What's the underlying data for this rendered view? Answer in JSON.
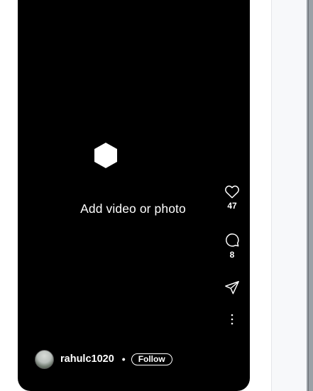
{
  "reel": {
    "placeholder_text": "Add video or photo",
    "actions": {
      "like_count": "47",
      "comment_count": "8"
    },
    "author": {
      "username": "rahulc1020",
      "separator": "•",
      "follow_label": "Follow"
    }
  },
  "icons": {
    "media": "hexagon-icon",
    "like": "heart-icon",
    "comment": "comment-bubble-icon",
    "share": "paper-plane-icon",
    "more": "more-vertical-icon"
  },
  "colors": {
    "card_background": "#000000",
    "foreground": "#ffffff",
    "side_panel": "#f7f8fa"
  }
}
